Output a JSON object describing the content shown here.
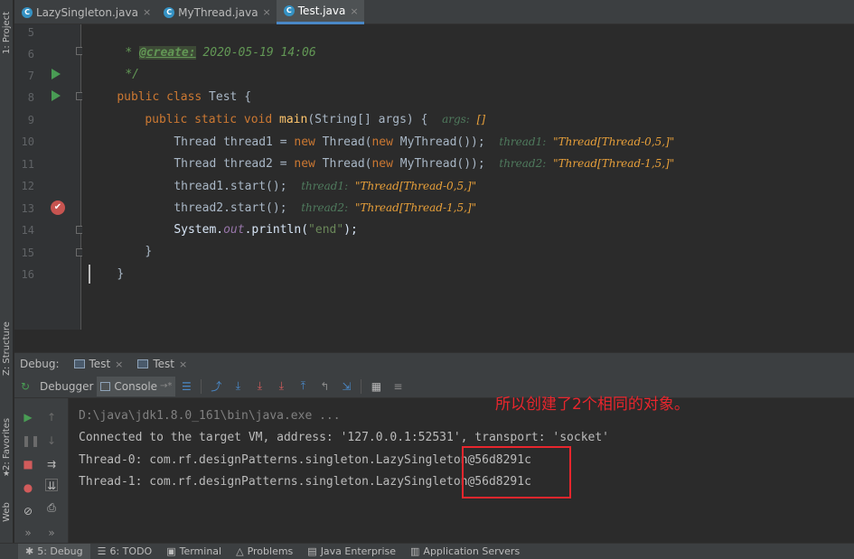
{
  "left_strip": {
    "project": "1: Project",
    "structure": "Z: Structure",
    "favorites": "2: Favorites",
    "web": "Web"
  },
  "tabs": [
    {
      "label": "LazySingleton.java",
      "icon": "c-class-icon",
      "active": false
    },
    {
      "label": "MyThread.java",
      "icon": "c-class-icon",
      "active": false
    },
    {
      "label": "Test.java",
      "icon": "c-class-icon",
      "active": true
    }
  ],
  "code": {
    "line_numbers": [
      "5",
      "6",
      "7",
      "8",
      "9",
      "10",
      "11",
      "12",
      "13",
      "14",
      "15",
      "16"
    ],
    "l5_star": "* ",
    "l5_tag": "@create:",
    "l5_rest": " 2020-05-19 14:06",
    "l6": "*/",
    "l7_kw": "public class",
    "l7_rest": " Test {",
    "l8_kw": "public static void",
    "l8_fn": "main",
    "l8_rest": "(String[] args) {",
    "l8_hint_name": "args:",
    "l8_hint_val": "[]",
    "l9_a": "Thread thread1 = ",
    "l9_new1": "new",
    "l9_b": " Thread(",
    "l9_new2": "new",
    "l9_c": " MyThread());",
    "l9_hint_name": "thread1:",
    "l9_hint_val": "\"Thread[Thread-0,5,]\"",
    "l10_a": "Thread thread2 = ",
    "l10_new1": "new",
    "l10_b": " Thread(",
    "l10_new2": "new",
    "l10_c": " MyThread());",
    "l10_hint_name": "thread2:",
    "l10_hint_val": "\"Thread[Thread-1,5,]\"",
    "l11": "thread1.start();",
    "l11_hint_name": "thread1:",
    "l11_hint_val": "\"Thread[Thread-0,5,]\"",
    "l12": "thread2.start();",
    "l12_hint_name": "thread2:",
    "l12_hint_val": "\"Thread[Thread-1,5,]\"",
    "l13_a": "System.",
    "l13_fld": "out",
    "l13_b": ".println(",
    "l13_str": "\"end\"",
    "l13_c": ");",
    "l14": "}",
    "l15": "}"
  },
  "debug": {
    "title": "Debug:",
    "tabs": [
      "Test",
      "Test"
    ],
    "debugger_tab": "Debugger",
    "console_tab": "Console"
  },
  "console": {
    "lines": [
      "D:\\java\\jdk1.8.0_161\\bin\\java.exe ...",
      "Connected to the target VM, address: '127.0.0.1:52531', transport: 'socket'",
      "Thread-0: com.rf.designPatterns.singleton.LazySingleton@56d8291c",
      "Thread-1: com.rf.designPatterns.singleton.LazySingleton@56d8291c"
    ]
  },
  "annotation": "所以创建了2个相同的对象。",
  "statusbar": [
    "5: Debug",
    "6: TODO",
    "Terminal",
    "Problems",
    "Java Enterprise",
    "Application Servers"
  ],
  "colors": {
    "highlight_line": "#2d6099",
    "annotation_red": "#e8262d",
    "run_green": "#499c54",
    "breakpoint_red": "#c75450"
  }
}
